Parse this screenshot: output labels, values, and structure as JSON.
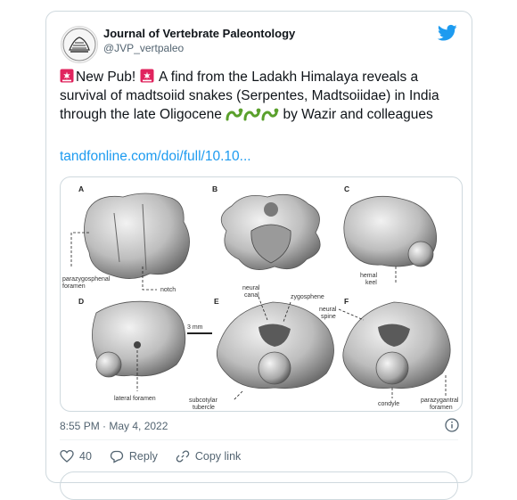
{
  "account": {
    "name": "Journal of Vertebrate Paleontology",
    "handle": "@JVP_vertpaleo"
  },
  "tweet": {
    "new_pub": "New Pub!",
    "text": "A find from the Ladakh Himalaya reveals a survival of madtsoiid snakes (Serpentes, Madtsoiidae) in India through the late Oligocene",
    "byline": "by Wazir and colleagues",
    "link": "tandfonline.com/doi/full/10.10...",
    "timestamp": "8:55 PM · May 4, 2022"
  },
  "figure": {
    "panels": [
      "A",
      "B",
      "C",
      "D",
      "E",
      "F"
    ],
    "labels": {
      "parazygosphenal": "parazygosphenal",
      "foramen": "foramen",
      "notch": "notch",
      "hemal": "hemal",
      "keel": "keel",
      "neural": "neural",
      "canal": "canal",
      "zygosphene": "zygosphene",
      "spine": "spine",
      "scale": "3 mm",
      "lateral_foramen": "lateral foramen",
      "subcotylar": "subcotylar",
      "tubercle": "tubercle",
      "condyle": "condyle",
      "parazygantral": "parazygantral"
    }
  },
  "actions": {
    "likes": "40",
    "reply": "Reply",
    "copy_link": "Copy link"
  },
  "icons": {
    "twitter": "twitter-bird-icon",
    "siren": "rotating-light-icon",
    "snake": "snake-icon",
    "info": "info-icon",
    "heart": "heart-icon",
    "reply": "reply-icon",
    "link": "link-icon"
  },
  "colors": {
    "link": "#1d9bf0",
    "twitter": "#1d9bf0",
    "muted": "#536471"
  }
}
